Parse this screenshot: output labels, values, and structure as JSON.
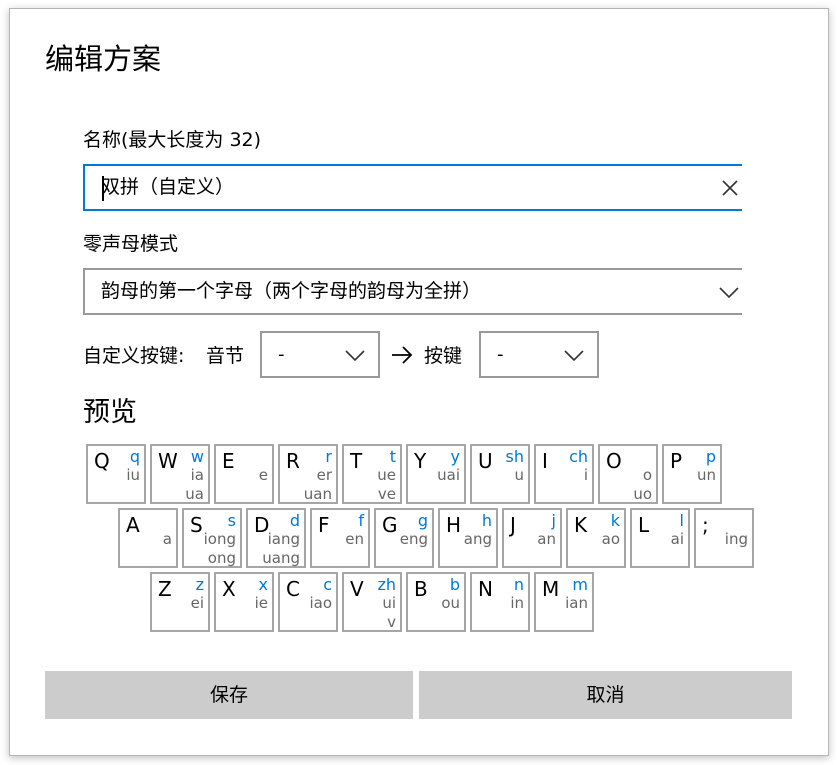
{
  "title": "编辑方案",
  "name_label": "名称(最大长度为 32)",
  "name_value": "双拼（自定义）",
  "zero_initial_label": "零声母模式",
  "zero_initial_value": "韵母的第一个字母（两个字母的韵母为全拼）",
  "custom_key": {
    "label": "自定义按键:",
    "syllable_label": "音节",
    "syllable_value": "-",
    "arrow": "→",
    "key_label": "按键",
    "key_value": "-"
  },
  "preview_label": "预览",
  "keyboard": {
    "row1": [
      {
        "k": "Q",
        "b": "q",
        "f1": "iu",
        "f2": ""
      },
      {
        "k": "W",
        "b": "w",
        "f1": "ia",
        "f2": "ua"
      },
      {
        "k": "E",
        "b": "",
        "f1": "e",
        "f2": ""
      },
      {
        "k": "R",
        "b": "r",
        "f1": "er",
        "f2": "uan"
      },
      {
        "k": "T",
        "b": "t",
        "f1": "ue",
        "f2": "ve"
      },
      {
        "k": "Y",
        "b": "y",
        "f1": "uai",
        "f2": ""
      },
      {
        "k": "U",
        "b": "sh",
        "f1": "u",
        "f2": ""
      },
      {
        "k": "I",
        "b": "ch",
        "f1": "i",
        "f2": ""
      },
      {
        "k": "O",
        "b": "",
        "f1": "o",
        "f2": "uo"
      },
      {
        "k": "P",
        "b": "p",
        "f1": "un",
        "f2": ""
      }
    ],
    "row2": [
      {
        "k": "A",
        "b": "",
        "f1": "a",
        "f2": ""
      },
      {
        "k": "S",
        "b": "s",
        "f1": "iong",
        "f2": "ong"
      },
      {
        "k": "D",
        "b": "d",
        "f1": "iang",
        "f2": "uang"
      },
      {
        "k": "F",
        "b": "f",
        "f1": "en",
        "f2": ""
      },
      {
        "k": "G",
        "b": "g",
        "f1": "eng",
        "f2": ""
      },
      {
        "k": "H",
        "b": "h",
        "f1": "ang",
        "f2": ""
      },
      {
        "k": "J",
        "b": "j",
        "f1": "an",
        "f2": ""
      },
      {
        "k": "K",
        "b": "k",
        "f1": "ao",
        "f2": ""
      },
      {
        "k": "L",
        "b": "l",
        "f1": "ai",
        "f2": ""
      },
      {
        "k": ";",
        "b": "",
        "f1": "ing",
        "f2": ""
      }
    ],
    "row3": [
      {
        "k": "Z",
        "b": "z",
        "f1": "ei",
        "f2": ""
      },
      {
        "k": "X",
        "b": "x",
        "f1": "ie",
        "f2": ""
      },
      {
        "k": "C",
        "b": "c",
        "f1": "iao",
        "f2": ""
      },
      {
        "k": "V",
        "b": "zh",
        "f1": "ui",
        "f2": "v"
      },
      {
        "k": "B",
        "b": "b",
        "f1": "ou",
        "f2": ""
      },
      {
        "k": "N",
        "b": "n",
        "f1": "in",
        "f2": ""
      },
      {
        "k": "M",
        "b": "m",
        "f1": "ian",
        "f2": ""
      }
    ]
  },
  "buttons": {
    "save": "保存",
    "cancel": "取消"
  },
  "colors": {
    "accent": "#0078d7",
    "button_bg": "#cccccc",
    "key_border": "#a6a6a6"
  }
}
